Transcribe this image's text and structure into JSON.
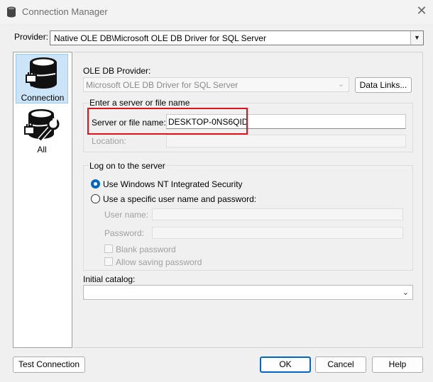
{
  "window": {
    "title": "Connection Manager",
    "close_glyph": "✕"
  },
  "provider": {
    "label": "Provider:",
    "value": "Native OLE DB\\Microsoft OLE DB Driver for SQL Server"
  },
  "sidebar": {
    "items": [
      {
        "label": "Connection",
        "icon": "database-plug-icon",
        "selected": true
      },
      {
        "label": "All",
        "icon": "database-wrench-icon",
        "selected": false
      }
    ]
  },
  "oledb": {
    "label": "OLE DB Provider:",
    "value": "Microsoft OLE DB Driver for SQL Server",
    "data_links_label": "Data Links..."
  },
  "server_group": {
    "legend": "Enter a server or file name",
    "server_label": "Server or file name:",
    "server_value": "DESKTOP-0NS6QID",
    "location_label": "Location:"
  },
  "logon_group": {
    "legend": "Log on to the server",
    "windows_auth_label": "Use Windows NT Integrated Security",
    "windows_auth_selected": true,
    "sql_auth_label": "Use a specific user name and password:",
    "username_label": "User name:",
    "password_label": "Password:",
    "blank_password_label": "Blank password",
    "allow_saving_label": "Allow saving password"
  },
  "catalog": {
    "label": "Initial catalog:",
    "value": ""
  },
  "buttons": {
    "test": "Test Connection",
    "ok": "OK",
    "cancel": "Cancel",
    "help": "Help"
  },
  "colors": {
    "highlight": "#e0121c",
    "accent": "#0067c0",
    "selection": "#cce4f7"
  }
}
